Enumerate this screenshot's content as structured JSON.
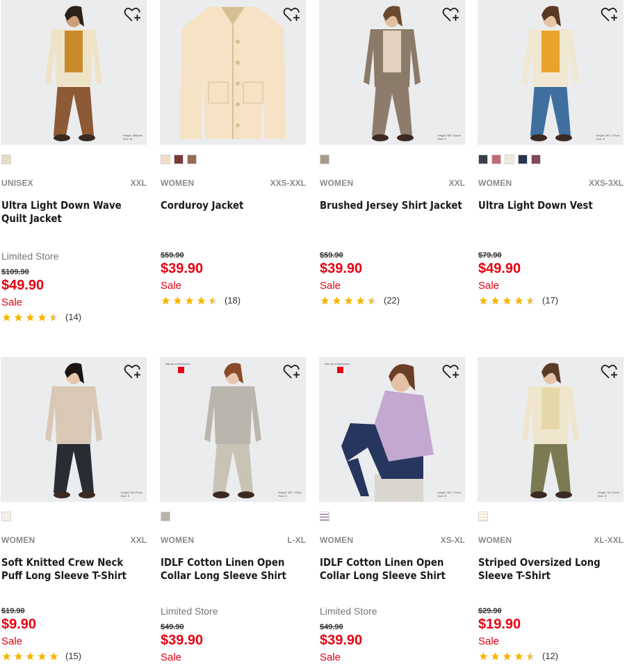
{
  "products": [
    {
      "gender": "UNISEX",
      "size": "XXL",
      "name": "Ultra Light Down Wave Quilt Jacket",
      "limited": "Limited Store",
      "original_price": "$109.90",
      "price": "$49.90",
      "sale": "Sale",
      "rating": 4.5,
      "reviews": "(14)",
      "swatches": [
        "#e7dcc6"
      ],
      "measurement": [
        "Height: 6ft80cm",
        "Size: M"
      ],
      "figure": "person",
      "colors": {
        "top": "#efe3c7",
        "accent": "#c98a2a",
        "bottom": "#8c5a35",
        "hair": "#2b2118",
        "skin": "#c9a079"
      }
    },
    {
      "gender": "WOMEN",
      "size": "XXS-XXL",
      "name": "Corduroy Jacket",
      "limited": "",
      "original_price": "$59.90",
      "price": "$39.90",
      "sale": "Sale",
      "rating": 4.5,
      "reviews": "(18)",
      "swatches": [
        "#f3dcc6",
        "#7a3a33",
        "#9a6a55"
      ],
      "measurement": [],
      "figure": "jacket",
      "colors": {
        "top": "#f6e3c6",
        "accent": "#d8bf93"
      }
    },
    {
      "gender": "WOMEN",
      "size": "XXL",
      "name": "Brushed Jersey Shirt Jacket",
      "limited": "",
      "original_price": "$59.90",
      "price": "$39.90",
      "sale": "Sale",
      "rating": 4.5,
      "reviews": "(22)",
      "swatches": [
        "#a89a8a"
      ],
      "measurement": [
        "Height: 5ft7 164cm",
        "Size: S"
      ],
      "figure": "person",
      "colors": {
        "top": "#8a7a68",
        "accent": "#e3d3c0",
        "bottom": "#8d7c6c",
        "hair": "#6a4a30",
        "skin": "#e0bfa0"
      }
    },
    {
      "gender": "WOMEN",
      "size": "XXS-3XL",
      "name": "Ultra Light Down Vest",
      "limited": "",
      "original_price": "$79.90",
      "price": "$49.90",
      "sale": "Sale",
      "rating": 4.5,
      "reviews": "(17)",
      "swatches": [
        "#3b3f46",
        "#c46a73",
        "#eeeae0",
        "#2b3352",
        "#7e4a5c"
      ],
      "measurement": [
        "Height: 5ft7 174cm",
        "Size: S"
      ],
      "figure": "person",
      "colors": {
        "top": "#f1e8d2",
        "accent": "#e9a32c",
        "bottom": "#3e6f9e",
        "hair": "#5a3a26",
        "skin": "#e5c4a5"
      }
    },
    {
      "gender": "WOMEN",
      "size": "XXL",
      "name": "Soft Knitted Crew Neck Puff Long Sleeve T-Shirt",
      "limited": "",
      "original_price": "$19.90",
      "price": "$9.90",
      "sale": "Sale",
      "rating": 5,
      "reviews": "(15)",
      "swatches": [
        "#f4f0e8"
      ],
      "measurement": [
        "Height: 5ft 170cm",
        "Size: S"
      ],
      "figure": "person",
      "colors": {
        "top": "#d9c8b5",
        "accent": "#d9c8b5",
        "bottom": "#2a2c33",
        "hair": "#1a1412",
        "skin": "#e6c7ac"
      }
    },
    {
      "gender": "WOMEN",
      "size": "L-XL",
      "name": "IDLF Cotton Linen Open Collar Long Sleeve Shirt",
      "limited": "Limited Store",
      "original_price": "$49.90",
      "price": "$39.90",
      "sale": "Sale",
      "rating": 0,
      "reviews": "",
      "swatches": [
        "#b7b3aa"
      ],
      "measurement": [
        "Height: 5ft7 170cm",
        "Size: S"
      ],
      "brand_tag": "INES DE LA FRESSANGE",
      "figure": "person",
      "colors": {
        "top": "#b9b6ad",
        "accent": "#b9b6ad",
        "bottom": "#c9c3b6",
        "hair": "#8a4a2a",
        "skin": "#e7c7ad"
      }
    },
    {
      "gender": "WOMEN",
      "size": "XS-XL",
      "name": "IDLF Cotton Linen Open Collar Long Sleeve Shirt",
      "limited": "Limited Store",
      "original_price": "$49.90",
      "price": "$39.90",
      "sale": "Sale",
      "rating": 0,
      "reviews": "",
      "swatches": [
        "#b79ab7"
      ],
      "measurement": [
        "Height: 5ft7 170cm",
        "Size: S"
      ],
      "brand_tag": "INES DE LA FRESSANGE",
      "figure": "seated",
      "colors": {
        "top": "#c3a8cf",
        "accent": "#9d7cae",
        "bottom": "#26365f",
        "hair": "#6b3f25",
        "skin": "#e3c0a4"
      }
    },
    {
      "gender": "WOMEN",
      "size": "XL-XXL",
      "name": "Striped Oversized Long Sleeve T-Shirt",
      "limited": "",
      "original_price": "$29.90",
      "price": "$19.90",
      "sale": "Sale",
      "rating": 4.5,
      "reviews": "(12)",
      "swatches": [
        "#efe4c4"
      ],
      "measurement": [
        "Height: 5ft 170cm",
        "Size: S"
      ],
      "figure": "person",
      "colors": {
        "top": "#efe6cd",
        "accent": "#e6d7a8",
        "bottom": "#7c7a52",
        "hair": "#5a3a28",
        "skin": "#e4c4a8"
      }
    }
  ]
}
